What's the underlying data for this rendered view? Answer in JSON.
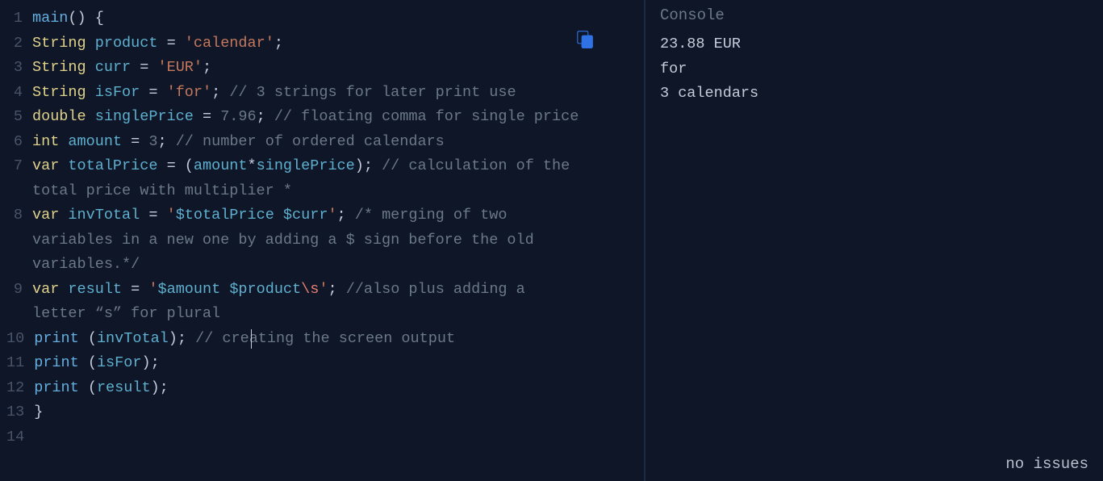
{
  "console": {
    "title": "Console",
    "output": "23.88 EUR\nfor\n3 calendars",
    "status": "no issues"
  },
  "editor": {
    "lines": [
      {
        "n": "1",
        "tokens": [
          [
            "fn",
            "main"
          ],
          [
            "pun",
            "() {"
          ]
        ]
      },
      {
        "n": "2",
        "tokens": [
          [
            "type",
            "String"
          ],
          [
            "pun",
            " "
          ],
          [
            "var",
            "product"
          ],
          [
            "pun",
            " "
          ],
          [
            "op",
            "="
          ],
          [
            "pun",
            " "
          ],
          [
            "strd",
            "'"
          ],
          [
            "str",
            "calendar"
          ],
          [
            "strd",
            "'"
          ],
          [
            "pun",
            ";"
          ]
        ]
      },
      {
        "n": "3",
        "tokens": [
          [
            "type",
            "String"
          ],
          [
            "pun",
            " "
          ],
          [
            "var",
            "curr"
          ],
          [
            "pun",
            " "
          ],
          [
            "op",
            "="
          ],
          [
            "pun",
            " "
          ],
          [
            "strd",
            "'"
          ],
          [
            "str",
            "EUR"
          ],
          [
            "strd",
            "'"
          ],
          [
            "pun",
            ";"
          ]
        ]
      },
      {
        "n": "4",
        "tokens": [
          [
            "type",
            "String"
          ],
          [
            "pun",
            " "
          ],
          [
            "var",
            "isFor"
          ],
          [
            "pun",
            " "
          ],
          [
            "op",
            "="
          ],
          [
            "pun",
            " "
          ],
          [
            "strd",
            "'"
          ],
          [
            "str",
            "for"
          ],
          [
            "strd",
            "'"
          ],
          [
            "pun",
            "; "
          ],
          [
            "cmt",
            "// 3 strings for later print use"
          ]
        ]
      },
      {
        "n": "5",
        "tokens": [
          [
            "type",
            "double"
          ],
          [
            "pun",
            " "
          ],
          [
            "var",
            "singlePrice"
          ],
          [
            "pun",
            " "
          ],
          [
            "op",
            "="
          ],
          [
            "pun",
            " "
          ],
          [
            "num",
            "7.96"
          ],
          [
            "pun",
            "; "
          ],
          [
            "cmt",
            "// floating comma for single price"
          ]
        ]
      },
      {
        "n": "6",
        "tokens": [
          [
            "type",
            "int"
          ],
          [
            "pun",
            " "
          ],
          [
            "var",
            "amount"
          ],
          [
            "pun",
            " "
          ],
          [
            "op",
            "="
          ],
          [
            "pun",
            " "
          ],
          [
            "num",
            "3"
          ],
          [
            "pun",
            "; "
          ],
          [
            "cmt",
            "// number of ordered calendars"
          ]
        ]
      },
      {
        "n": "7",
        "tokens": [
          [
            "type",
            "var"
          ],
          [
            "pun",
            " "
          ],
          [
            "var",
            "totalPrice"
          ],
          [
            "pun",
            " "
          ],
          [
            "op",
            "="
          ],
          [
            "pun",
            " ("
          ],
          [
            "var",
            "amount"
          ],
          [
            "op",
            "*"
          ],
          [
            "var",
            "singlePrice"
          ],
          [
            "pun",
            "); "
          ],
          [
            "cmt",
            "// calculation of the total price with multiplier *"
          ]
        ]
      },
      {
        "n": "8",
        "tokens": [
          [
            "type",
            "var"
          ],
          [
            "pun",
            " "
          ],
          [
            "var",
            "invTotal"
          ],
          [
            "pun",
            " "
          ],
          [
            "op",
            "="
          ],
          [
            "pun",
            " "
          ],
          [
            "strd",
            "'"
          ],
          [
            "strv",
            "$totalPrice"
          ],
          [
            "str",
            " "
          ],
          [
            "strv",
            "$curr"
          ],
          [
            "strd",
            "'"
          ],
          [
            "pun",
            "; "
          ],
          [
            "cmt",
            "/* merging of two variables in a new one by adding a $ sign before the old variables.*/"
          ]
        ]
      },
      {
        "n": "9",
        "tokens": [
          [
            "type",
            "var"
          ],
          [
            "pun",
            " "
          ],
          [
            "var",
            "result"
          ],
          [
            "pun",
            " "
          ],
          [
            "op",
            "="
          ],
          [
            "pun",
            " "
          ],
          [
            "strd",
            "'"
          ],
          [
            "strv",
            "$amount"
          ],
          [
            "str",
            " "
          ],
          [
            "strv",
            "$product"
          ],
          [
            "esc",
            "\\s"
          ],
          [
            "strd",
            "'"
          ],
          [
            "pun",
            "; "
          ],
          [
            "cmt",
            "//also plus adding a letter “s” for plural"
          ]
        ]
      },
      {
        "n": "10",
        "cursorLine": true,
        "tokens": [
          [
            "fn",
            "print"
          ],
          [
            "pun",
            " ("
          ],
          [
            "var",
            "invTotal"
          ],
          [
            "pun",
            "); "
          ],
          [
            "cmt",
            "// creating the screen output"
          ]
        ]
      },
      {
        "n": "11",
        "tokens": [
          [
            "fn",
            "print"
          ],
          [
            "pun",
            " ("
          ],
          [
            "var",
            "isFor"
          ],
          [
            "pun",
            ");"
          ]
        ]
      },
      {
        "n": "12",
        "tokens": [
          [
            "fn",
            "print"
          ],
          [
            "pun",
            " ("
          ],
          [
            "var",
            "result"
          ],
          [
            "pun",
            ");"
          ]
        ]
      },
      {
        "n": "13",
        "tokens": [
          [
            "pun",
            "}"
          ]
        ]
      },
      {
        "n": "14",
        "tokens": []
      }
    ]
  }
}
